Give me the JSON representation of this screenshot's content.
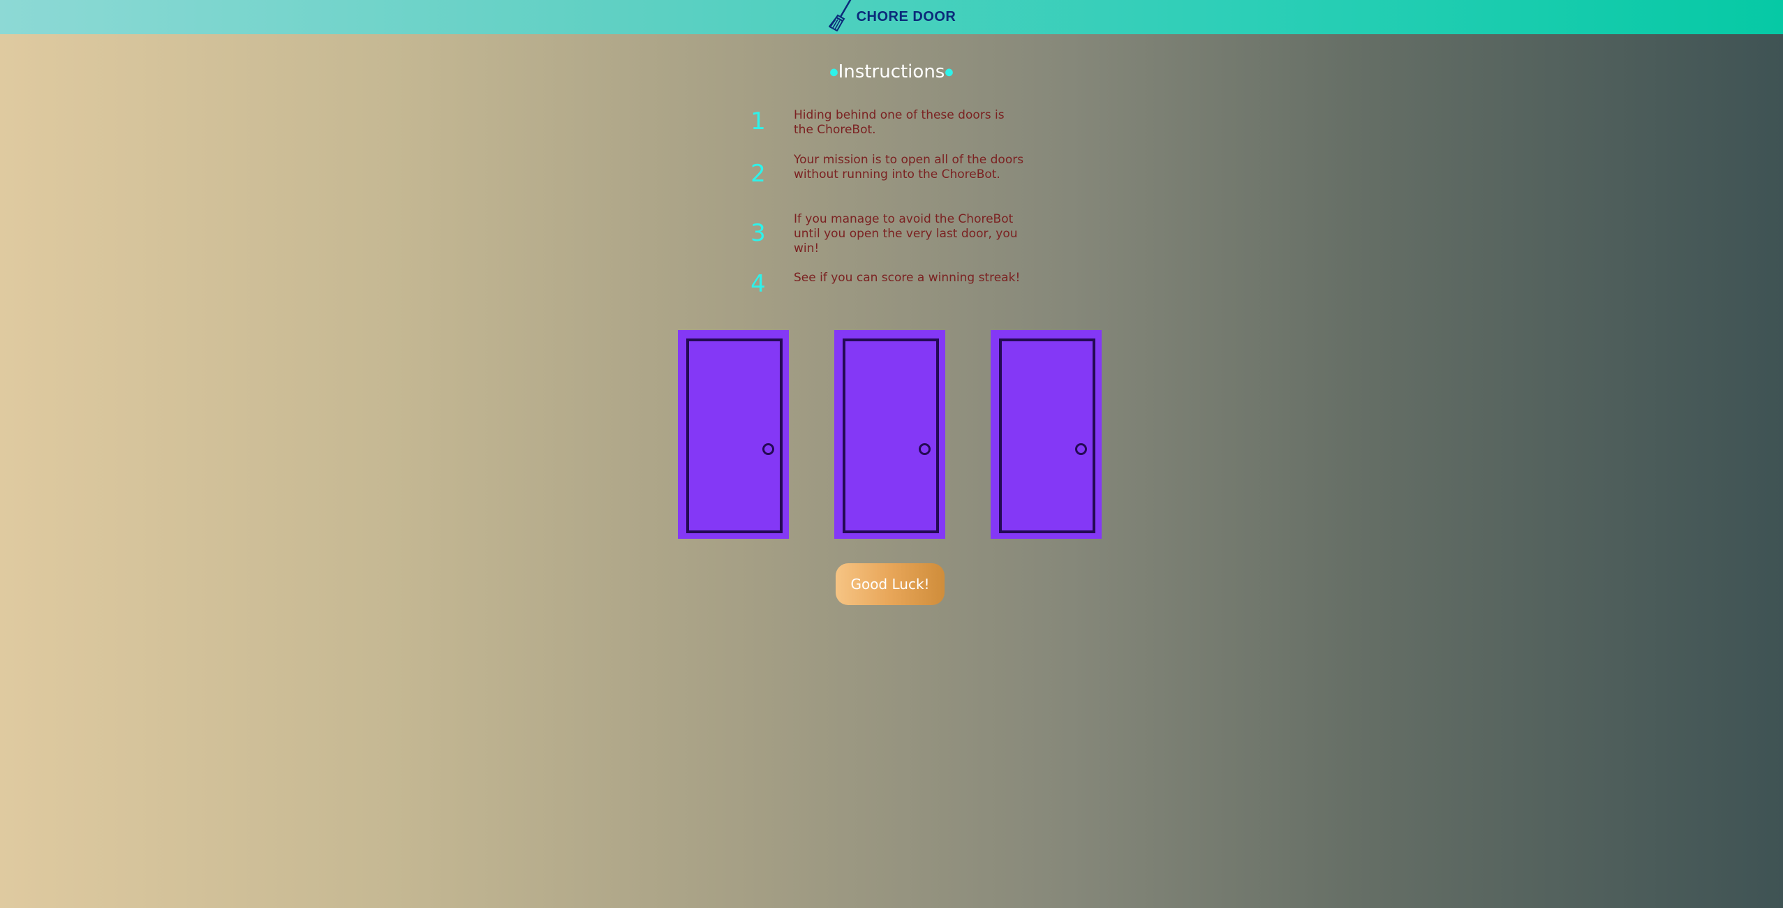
{
  "header": {
    "brand": "CHORE DOOR",
    "logo_icon": "broom-icon",
    "colors": {
      "bar_start": "#8dd9d5",
      "bar_end": "#06c9a5",
      "brand_text": "#0b2a7a"
    }
  },
  "instructions": {
    "title": "Instructions",
    "steps": [
      {
        "number": "1",
        "text": "Hiding behind one of these doors is the ChoreBot."
      },
      {
        "number": "2",
        "text": "Your mission is to open all of the doors without running into the ChoreBot."
      },
      {
        "number": "3",
        "text": "If you manage to avoid the ChoreBot until you open the very last door, you win!"
      },
      {
        "number": "4",
        "text": "See if you can score a winning streak!"
      }
    ],
    "colors": {
      "number": "#2ef2ea",
      "text": "#7b2222"
    }
  },
  "doors": {
    "count": 3,
    "icon": "closed-door-icon",
    "colors": {
      "door": "#8438f6",
      "outline": "#240a55"
    }
  },
  "start_button": {
    "label": "Good Luck!",
    "colors": {
      "from": "#f6c484",
      "to": "#cf8d3b"
    }
  }
}
